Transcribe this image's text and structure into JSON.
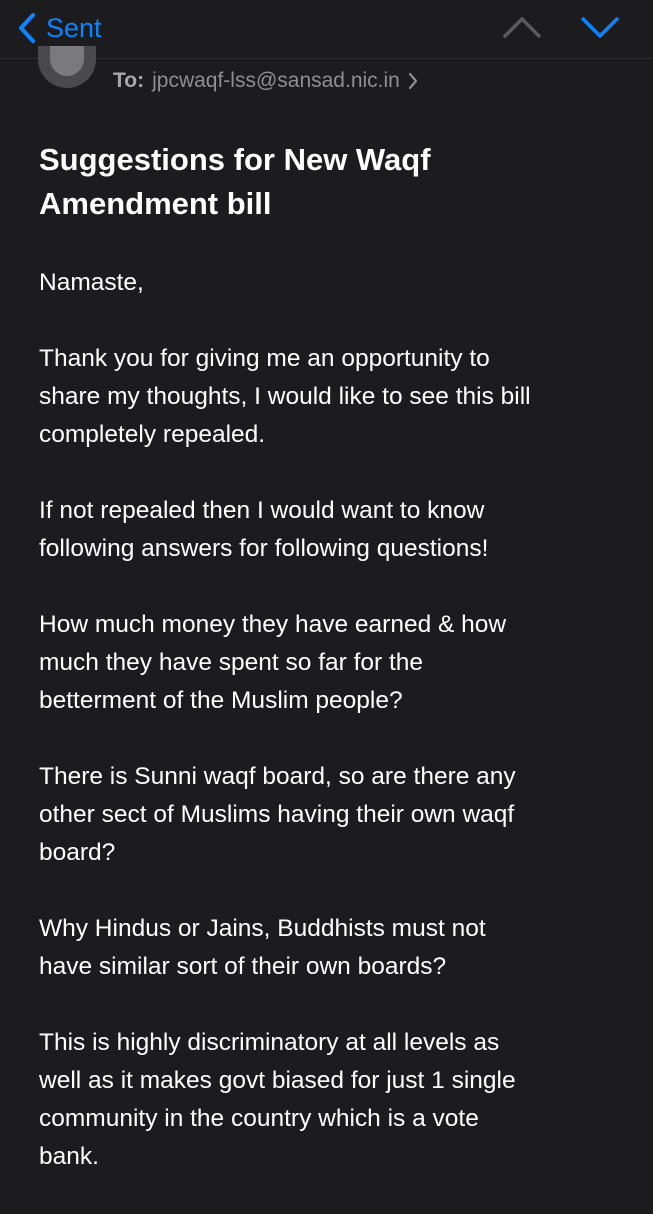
{
  "nav": {
    "back_label": "Sent",
    "accent_color": "#0a84ff"
  },
  "header": {
    "to_label": "To:",
    "to_address": "jpcwaqf-lss@sansad.nic.in"
  },
  "email": {
    "subject": "Suggestions for New Waqf\nAmendment bill",
    "paragraphs": [
      "Namaste,",
      "Thank you for giving me an opportunity to\nshare my thoughts, I would like to see this bill\ncompletely repealed.",
      "If not repealed then I would want to know\nfollowing answers for following questions!",
      "How much money they have earned & how\nmuch they have spent so far for the\nbetterment of the Muslim people?",
      "There is Sunni waqf board, so are there any\nother sect of Muslims having their own waqf\nboard?",
      "Why Hindus or Jains, Buddhists must not\nhave similar sort of their own boards?",
      "This is highly discriminatory at all levels as\nwell as it makes govt biased for just 1 single\ncommunity in the country which is a vote\nbank."
    ]
  },
  "icons": {
    "back": "chevron-left-icon",
    "previous": "chevron-up-icon",
    "next": "chevron-down-icon",
    "recipient": "chevron-right-icon"
  }
}
